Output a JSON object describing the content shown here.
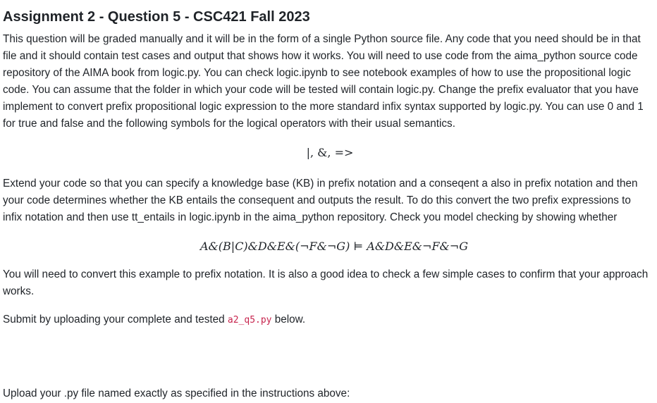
{
  "page": {
    "title": "Assignment 2 - Question 5 - CSC421 Fall 2023",
    "paragraph1": "This question will be graded manually and it will be in the form of a single Python source file. Any code that you need should be in that file and it should contain test cases and output that shows how it works. You will need to use code from the aima_python source code repository of the AIMA book from logic.py. You can check logic.ipynb to see notebook examples of how to use the propositional logic code. You can assume that the folder in which your code will be tested will contain logic.py. Change the prefix evaluator that you have implement to convert prefix propositional logic expression to the more standard infix syntax supported by logic.py. You can use 0 and 1 for true and false and the following symbols for the logical operators with their usual semantics.",
    "operators_math": "|, &, =>",
    "paragraph2": "Extend your code so that you can specify a knowledge base (KB) in prefix notation and a conseqent a also in prefix notation and then your code determines whether the KB entails the consequent and outputs the result. To do this convert the two prefix expressions to infix notation and then use tt_entails in logic.ipynb in the aima_python repository. Check you model checking by showing whether",
    "entailment_math": "A&(B|C)&D&E&(¬F&¬G) ⊨ A&D&E&¬F&¬G",
    "paragraph3": "You will need to convert this example to prefix notation. It is also a good idea to check a few simple cases to confirm that your approach works.",
    "paragraph4_prefix": "Submit by uploading your complete and tested ",
    "paragraph4_code": "a2_q5.py",
    "paragraph4_suffix": " below.",
    "upload_instruction": "Upload your .py file named exactly as specified in the instructions above:"
  }
}
